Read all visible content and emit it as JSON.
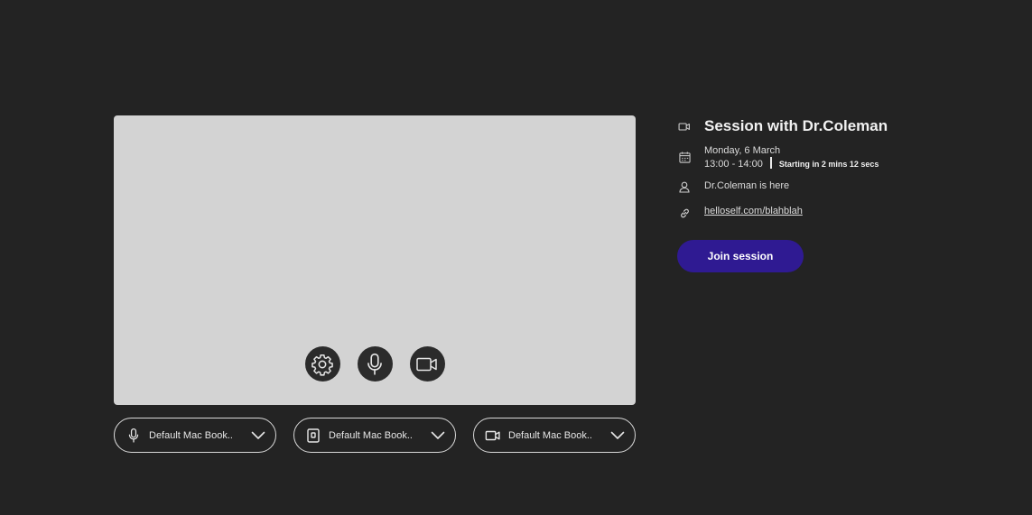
{
  "preview": {
    "controls": [
      {
        "name": "settings",
        "icon": "gear-icon"
      },
      {
        "name": "microphone",
        "icon": "microphone-icon"
      },
      {
        "name": "camera",
        "icon": "video-camera-icon"
      }
    ]
  },
  "selectors": [
    {
      "device": "microphone",
      "icon": "microphone-icon",
      "value": "Default Mac Book.."
    },
    {
      "device": "speaker",
      "icon": "speaker-icon",
      "value": "Default Mac Book.."
    },
    {
      "device": "camera",
      "icon": "video-camera-icon",
      "value": "Default Mac Book.."
    }
  ],
  "session": {
    "title": "Session with Dr.Coleman",
    "date": "Monday, 6 March",
    "time": "13:00 - 14:00",
    "countdown": "Starting in 2 mins 12 secs",
    "presence": "Dr.Coleman is here",
    "link": "helloself.com/blahblah",
    "join_label": "Join session"
  },
  "colors": {
    "background": "#232323",
    "preview": "#d3d3d3",
    "accent": "#2f1a92"
  }
}
